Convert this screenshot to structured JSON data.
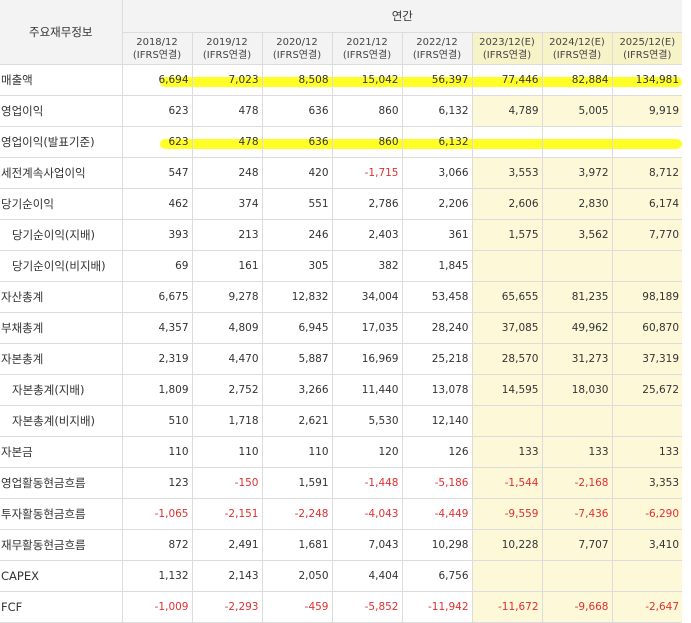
{
  "header": {
    "label": "주요재무정보",
    "group": "연간",
    "periods": [
      {
        "year": "2018/12",
        "basis": "(IFRS연결)",
        "estimate": false
      },
      {
        "year": "2019/12",
        "basis": "(IFRS연결)",
        "estimate": false
      },
      {
        "year": "2020/12",
        "basis": "(IFRS연결)",
        "estimate": false
      },
      {
        "year": "2021/12",
        "basis": "(IFRS연결)",
        "estimate": false
      },
      {
        "year": "2022/12",
        "basis": "(IFRS연결)",
        "estimate": false
      },
      {
        "year": "2023/12(E)",
        "basis": "(IFRS연결)",
        "estimate": true
      },
      {
        "year": "2024/12(E)",
        "basis": "(IFRS연결)",
        "estimate": true
      },
      {
        "year": "2025/12(E)",
        "basis": "(IFRS연결)",
        "estimate": true
      }
    ]
  },
  "rows": [
    {
      "label": "매출액",
      "indent": false,
      "highlighted": true,
      "values": [
        "6,694",
        "7,023",
        "8,508",
        "15,042",
        "56,397",
        "77,446",
        "82,884",
        "134,981"
      ]
    },
    {
      "label": "영업이익",
      "indent": false,
      "highlighted": false,
      "values": [
        "623",
        "478",
        "636",
        "860",
        "6,132",
        "4,789",
        "5,005",
        "9,919"
      ]
    },
    {
      "label": "영업이익(발표기준)",
      "indent": false,
      "highlighted": true,
      "values": [
        "623",
        "478",
        "636",
        "860",
        "6,132",
        "",
        "",
        ""
      ]
    },
    {
      "label": "세전계속사업이익",
      "indent": false,
      "highlighted": false,
      "values": [
        "547",
        "248",
        "420",
        "-1,715",
        "3,066",
        "3,553",
        "3,972",
        "8,712"
      ]
    },
    {
      "label": "당기순이익",
      "indent": false,
      "highlighted": false,
      "values": [
        "462",
        "374",
        "551",
        "2,786",
        "2,206",
        "2,606",
        "2,830",
        "6,174"
      ]
    },
    {
      "label": "당기순이익(지배)",
      "indent": true,
      "highlighted": false,
      "values": [
        "393",
        "213",
        "246",
        "2,403",
        "361",
        "1,575",
        "3,562",
        "7,770"
      ]
    },
    {
      "label": "당기순이익(비지배)",
      "indent": true,
      "highlighted": false,
      "values": [
        "69",
        "161",
        "305",
        "382",
        "1,845",
        "",
        "",
        ""
      ]
    },
    {
      "label": "자산총계",
      "indent": false,
      "highlighted": false,
      "values": [
        "6,675",
        "9,278",
        "12,832",
        "34,004",
        "53,458",
        "65,655",
        "81,235",
        "98,189"
      ]
    },
    {
      "label": "부채총계",
      "indent": false,
      "highlighted": false,
      "values": [
        "4,357",
        "4,809",
        "6,945",
        "17,035",
        "28,240",
        "37,085",
        "49,962",
        "60,870"
      ]
    },
    {
      "label": "자본총계",
      "indent": false,
      "highlighted": false,
      "values": [
        "2,319",
        "4,470",
        "5,887",
        "16,969",
        "25,218",
        "28,570",
        "31,273",
        "37,319"
      ]
    },
    {
      "label": "자본총계(지배)",
      "indent": true,
      "highlighted": false,
      "values": [
        "1,809",
        "2,752",
        "3,266",
        "11,440",
        "13,078",
        "14,595",
        "18,030",
        "25,672"
      ]
    },
    {
      "label": "자본총계(비지배)",
      "indent": true,
      "highlighted": false,
      "values": [
        "510",
        "1,718",
        "2,621",
        "5,530",
        "12,140",
        "",
        "",
        ""
      ]
    },
    {
      "label": "자본금",
      "indent": false,
      "highlighted": false,
      "values": [
        "110",
        "110",
        "110",
        "120",
        "126",
        "133",
        "133",
        "133"
      ]
    },
    {
      "label": "영업활동현금흐름",
      "indent": false,
      "highlighted": false,
      "values": [
        "123",
        "-150",
        "1,591",
        "-1,448",
        "-5,186",
        "-1,544",
        "-2,168",
        "3,353"
      ]
    },
    {
      "label": "투자활동현금흐름",
      "indent": false,
      "highlighted": false,
      "values": [
        "-1,065",
        "-2,151",
        "-2,248",
        "-4,043",
        "-4,449",
        "-9,559",
        "-7,436",
        "-6,290"
      ]
    },
    {
      "label": "재무활동현금흐름",
      "indent": false,
      "highlighted": false,
      "values": [
        "872",
        "2,491",
        "1,681",
        "7,043",
        "10,298",
        "10,228",
        "7,707",
        "3,410"
      ]
    },
    {
      "label": "CAPEX",
      "indent": false,
      "highlighted": false,
      "values": [
        "1,132",
        "2,143",
        "2,050",
        "4,404",
        "6,756",
        "",
        "",
        ""
      ]
    },
    {
      "label": "FCF",
      "indent": false,
      "highlighted": false,
      "values": [
        "-1,009",
        "-2,293",
        "-459",
        "-5,852",
        "-11,942",
        "-11,672",
        "-9,668",
        "-2,647"
      ]
    }
  ],
  "colors": {
    "negative": "#e03030",
    "estimate_bg": "#fdf9d8",
    "highlight": "#ffff00"
  }
}
